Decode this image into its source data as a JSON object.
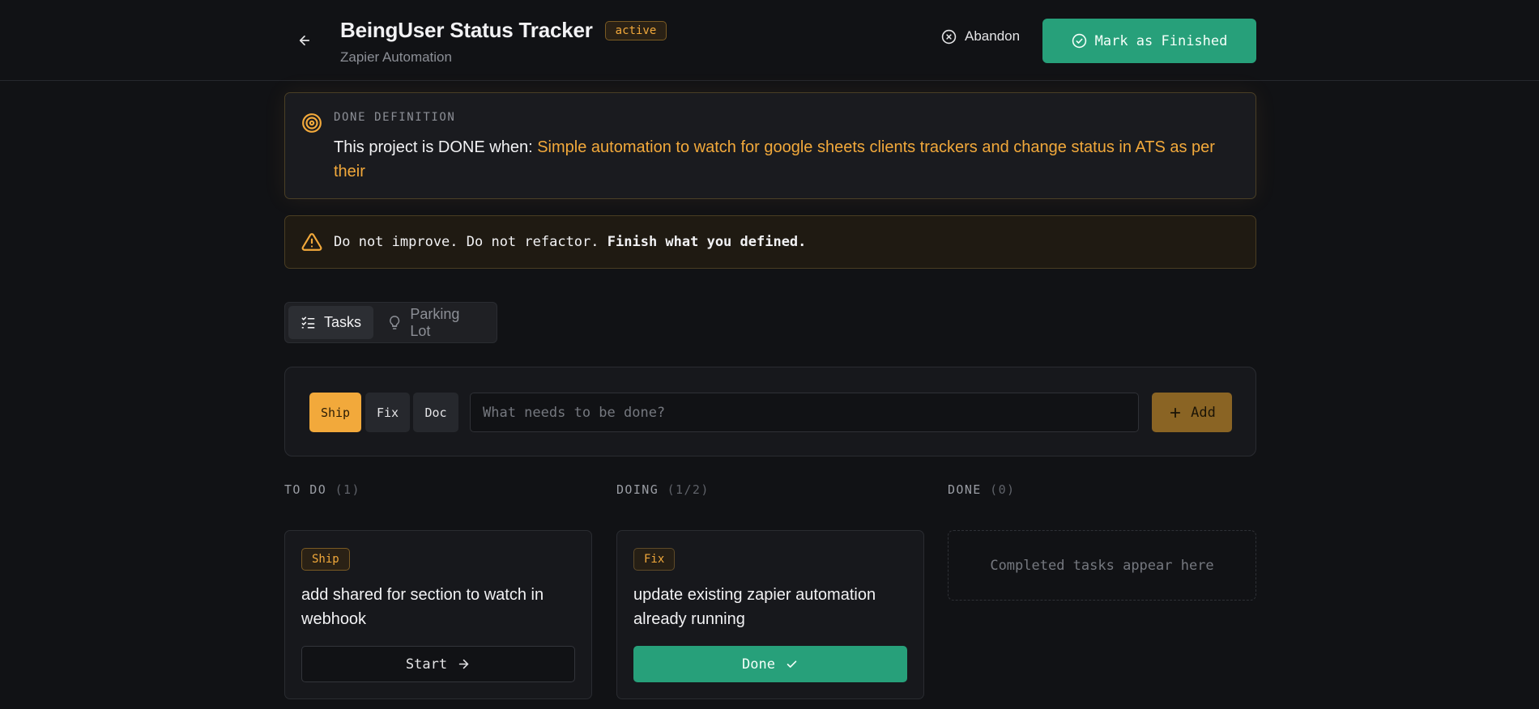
{
  "header": {
    "title": "BeingUser Status Tracker",
    "status": "active",
    "subtitle": "Zapier Automation",
    "abandon_label": "Abandon",
    "finish_label": "Mark as Finished"
  },
  "done_definition": {
    "label": "DONE DEFINITION",
    "prefix": "This project is DONE when: ",
    "text": "Simple automation to watch for google sheets clients trackers and change status in ATS as per their"
  },
  "warning": {
    "text": "Do not improve. Do not refactor. ",
    "emphasis": "Finish what you defined."
  },
  "tabs": [
    {
      "label": "Tasks",
      "icon": "checklist-icon",
      "active": true
    },
    {
      "label": "Parking Lot",
      "icon": "lightbulb-icon",
      "active": false
    }
  ],
  "add_task": {
    "types": [
      "Ship",
      "Fix",
      "Doc"
    ],
    "selected_type": "Ship",
    "placeholder": "What needs to be done?",
    "value": "",
    "add_label": "Add"
  },
  "columns": {
    "todo": {
      "title": "TO DO",
      "count": "(1)"
    },
    "doing": {
      "title": "DOING",
      "count": "(1/2)"
    },
    "done": {
      "title": "DONE",
      "count": "(0)",
      "empty_text": "Completed tasks appear here"
    }
  },
  "tasks": {
    "todo": [
      {
        "tag": "Ship",
        "title": "add shared for section to watch in webhook",
        "action": "Start"
      }
    ],
    "doing": [
      {
        "tag": "Fix",
        "title": "update existing zapier automation already running",
        "action": "Done"
      }
    ]
  },
  "colors": {
    "accent": "#f2a93b",
    "success": "#27a07a",
    "background": "#111215"
  }
}
